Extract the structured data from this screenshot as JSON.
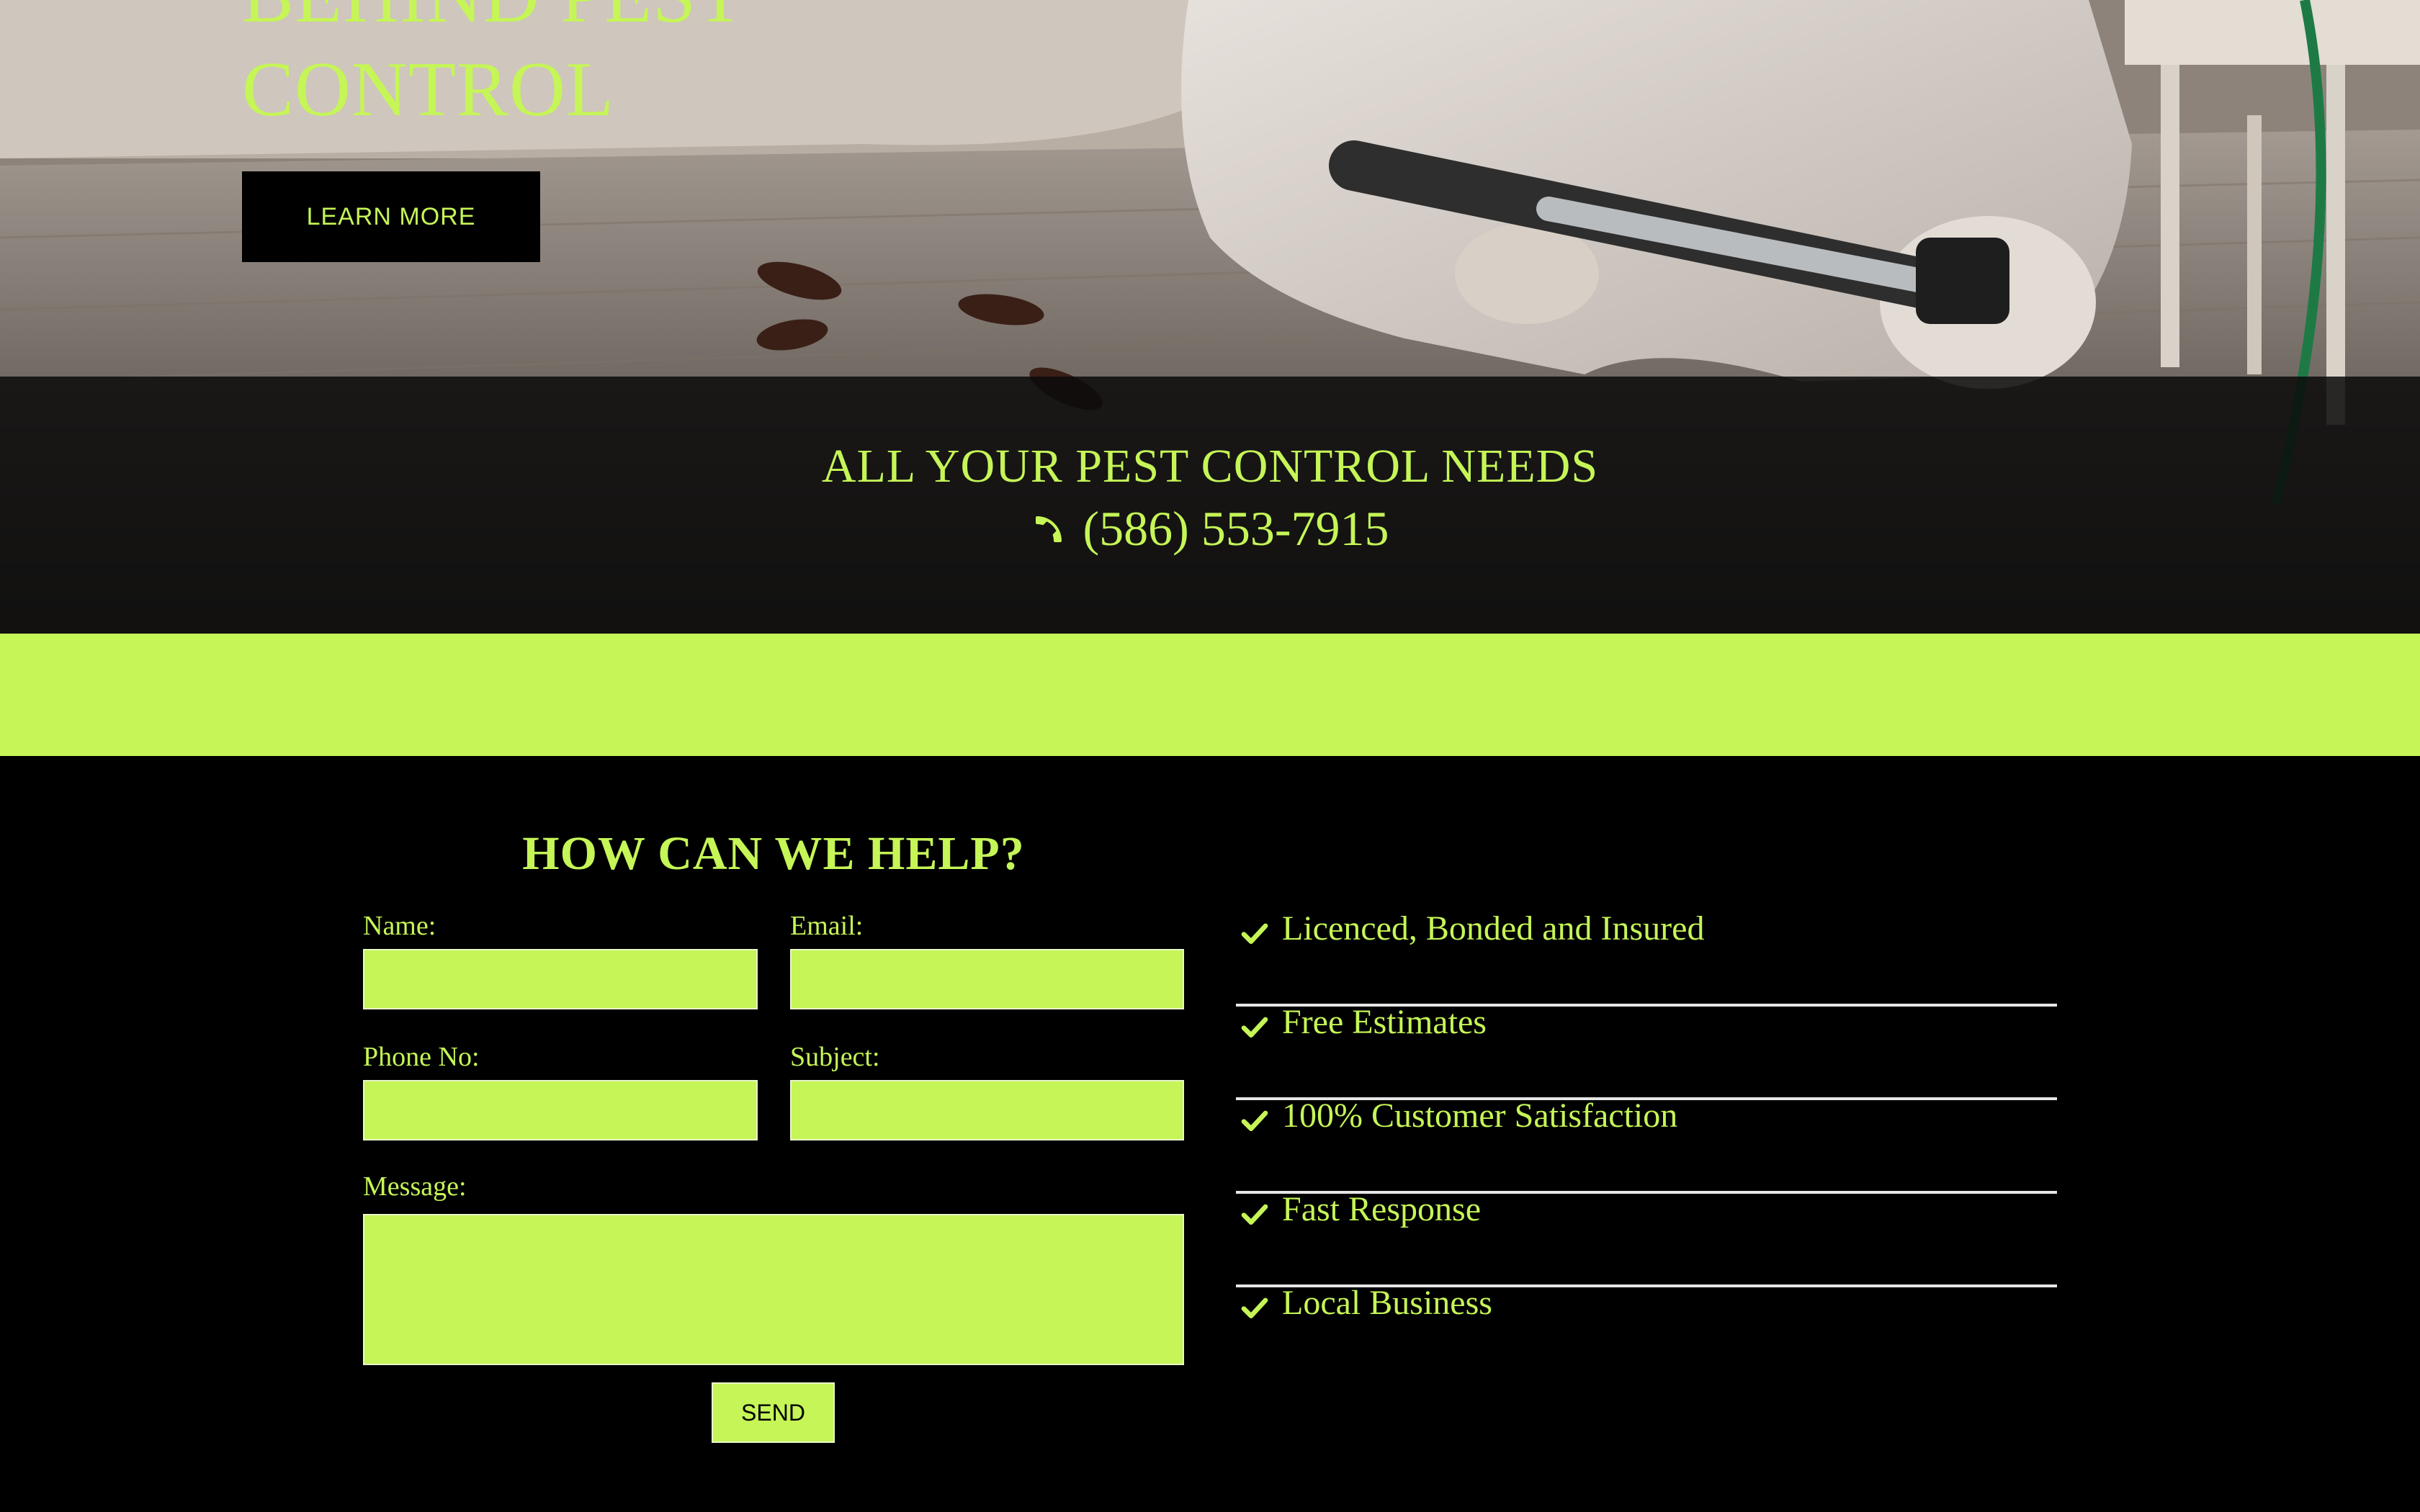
{
  "hero": {
    "title_line_1": "BEHIND PEST",
    "title_line_2": "CONTROL",
    "learn_more_label": "LEARN MORE"
  },
  "banner": {
    "title": "ALL YOUR PEST CONTROL NEEDS",
    "phone": "(586) 553-7915",
    "phone_icon": "phone-icon"
  },
  "contact": {
    "title": "HOW CAN WE HELP?",
    "fields": {
      "name": {
        "label": "Name:",
        "value": ""
      },
      "email": {
        "label": "Email:",
        "value": ""
      },
      "phone": {
        "label": "Phone No:",
        "value": ""
      },
      "subject": {
        "label": "Subject:",
        "value": ""
      },
      "message": {
        "label": "Message:",
        "value": ""
      }
    },
    "send_label": "SEND"
  },
  "features": {
    "icon": "check-icon",
    "items": [
      "Licenced, Bonded and Insured",
      "Free Estimates",
      "100% Customer Satisfaction",
      "Fast Response",
      "Local Business"
    ]
  },
  "colors": {
    "accent": "#c5f557",
    "background": "#000000",
    "divider": "#e6e6e6"
  }
}
